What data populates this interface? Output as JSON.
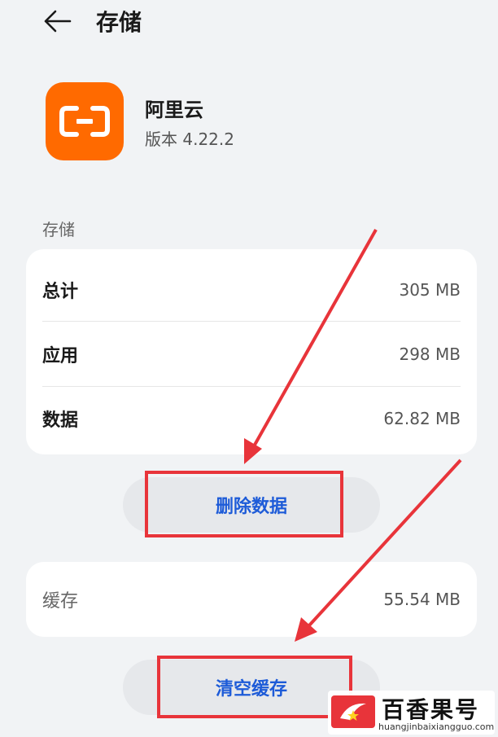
{
  "header": {
    "title": "存储",
    "back_icon": "arrow-left-icon"
  },
  "app": {
    "name": "阿里云",
    "version": "版本 4.22.2",
    "icon": "aliyun-logo-icon",
    "icon_color": "#ff6a00"
  },
  "storage": {
    "section_label": "存储",
    "rows": [
      {
        "label": "总计",
        "value": "305 MB"
      },
      {
        "label": "应用",
        "value": "298 MB"
      },
      {
        "label": "数据",
        "value": "62.82 MB"
      }
    ],
    "delete_button": "删除数据"
  },
  "cache": {
    "label": "缓存",
    "value": "55.54 MB",
    "clear_button": "清空缓存"
  },
  "annotation": {
    "color": "#e8343a"
  },
  "watermark": {
    "title": "百香果号",
    "url": "huangjinbaixiangguo.com"
  },
  "colors": {
    "background": "#f1f3f5",
    "card": "#ffffff",
    "button_text": "#1d5bd8",
    "button_bg": "#e6e8eb"
  }
}
